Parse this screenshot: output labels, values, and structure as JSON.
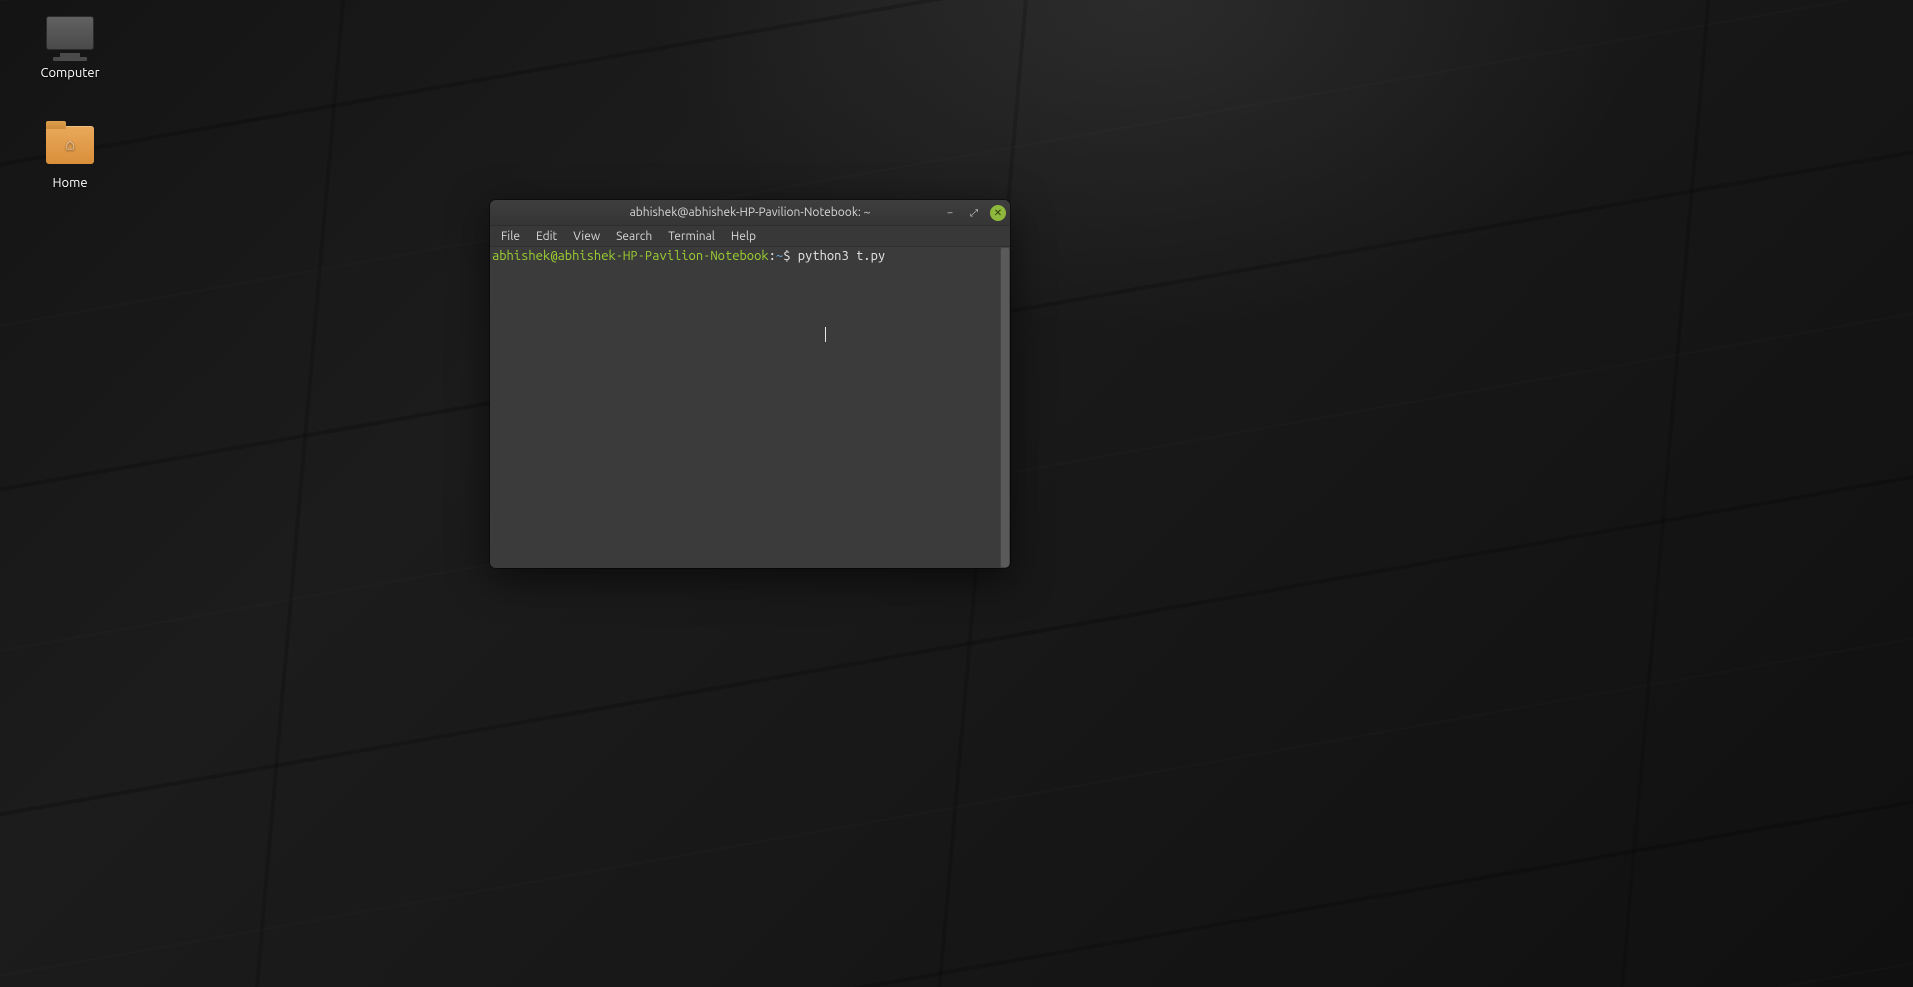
{
  "desktop": {
    "icons": {
      "computer": {
        "label": "Computer"
      },
      "home": {
        "label": "Home"
      }
    }
  },
  "terminal": {
    "title": "abhishek@abhishek-HP-Pavilion-Notebook: ~",
    "menus": {
      "file": "File",
      "edit": "Edit",
      "view": "View",
      "search": "Search",
      "terminal": "Terminal",
      "help": "Help"
    },
    "prompt": {
      "user_host": "abhishek@abhishek-HP-Pavilion-Notebook",
      "separator": ":",
      "path": "~",
      "symbol": "$",
      "command": "python3 t.py"
    },
    "window_controls": {
      "minimize": "–",
      "maximize": "⤢",
      "close": "✕"
    }
  }
}
